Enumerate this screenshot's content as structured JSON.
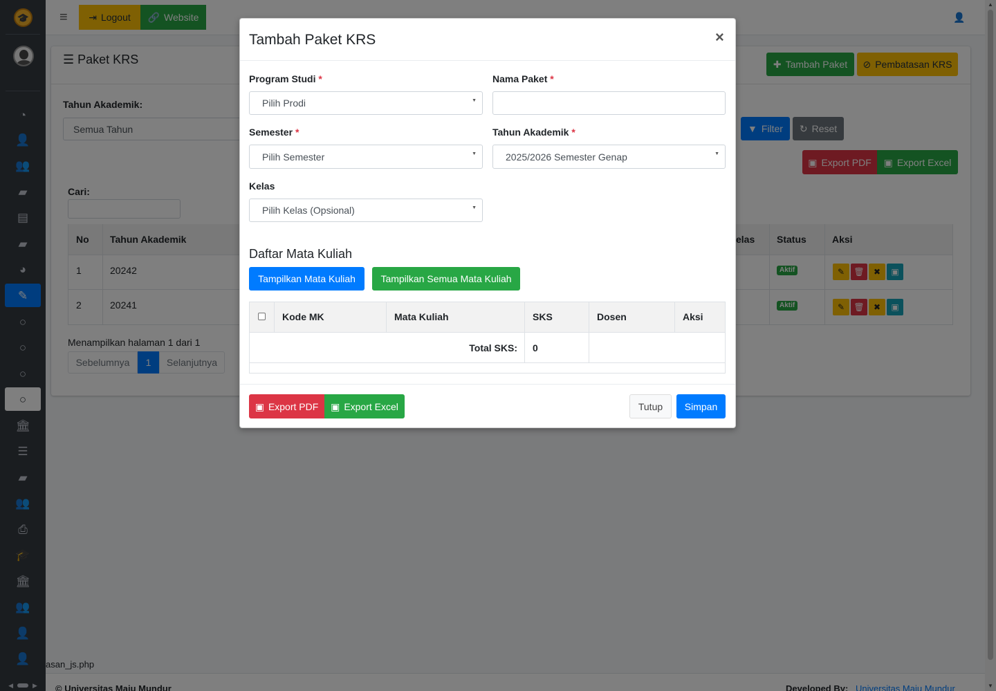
{
  "topbar": {
    "logout": "Logout",
    "website": "Website"
  },
  "page": {
    "title": "Paket KRS",
    "btn_tambah": "Tambah Paket",
    "btn_pembatasan": "Pembatasan KRS",
    "filter_label": "Tahun Akademik:",
    "filter_value": "Semua Tahun",
    "btn_filter": "Filter",
    "btn_reset": "Reset",
    "btn_export_pdf": "Export PDF",
    "btn_export_excel": "Export Excel",
    "search_label": "Cari:",
    "columns": [
      "No",
      "Tahun Akademik",
      "elas",
      "Status",
      "Aksi"
    ],
    "rows": [
      {
        "no": "1",
        "tahun": "20242",
        "status": "Aktif"
      },
      {
        "no": "2",
        "tahun": "20241",
        "status": "Aktif"
      }
    ],
    "info": "Menampilkan halaman 1 dari 1",
    "prev": "Sebelumnya",
    "page": "1",
    "next": "Selanjutnya"
  },
  "footer": {
    "file": "asan_js.php",
    "copyright": "© Universitas Maju Mundur",
    "dev_label": "Developed By:",
    "dev_name": "Universitas Maju Mundur"
  },
  "modal": {
    "title": "Tambah Paket KRS",
    "close": "×",
    "prodi_label": "Program Studi",
    "prodi_value": "Pilih Prodi",
    "nama_label": "Nama Paket",
    "nama_value": "",
    "semester_label": "Semester",
    "semester_value": "Pilih Semester",
    "tahun_label": "Tahun Akademik",
    "tahun_value": "2025/2026 Semester Genap",
    "kelas_label": "Kelas",
    "kelas_value": "Pilih Kelas (Opsional)",
    "required_mark": "*",
    "section_title": "Daftar Mata Kuliah",
    "btn_tampilkan": "Tampilkan Mata Kuliah",
    "btn_tampilkan_semua": "Tampilkan Semua Mata Kuliah",
    "columns": [
      "Kode MK",
      "Mata Kuliah",
      "SKS",
      "Dosen",
      "Aksi"
    ],
    "total_label": "Total SKS:",
    "total_value": "0",
    "btn_export_pdf": "Export PDF",
    "btn_export_excel": "Export Excel",
    "btn_tutup": "Tutup",
    "btn_simpan": "Simpan"
  },
  "colors": {
    "primary": "#007bff",
    "success": "#28a745",
    "danger": "#dc3545",
    "warning": "#ffc107",
    "sidebar": "#343a40"
  }
}
